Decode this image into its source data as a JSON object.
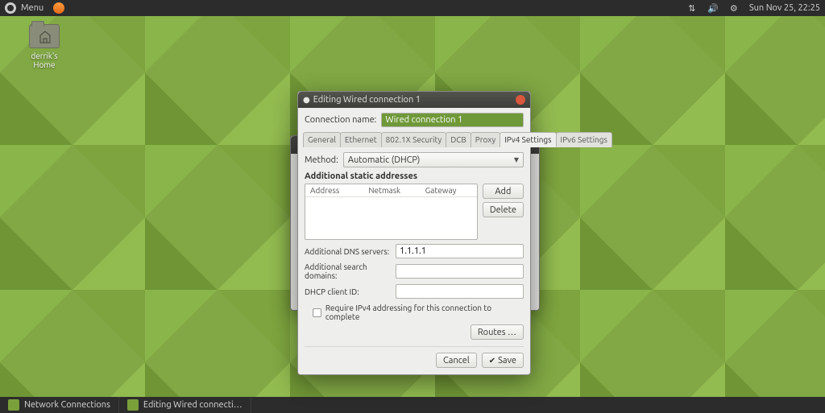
{
  "panel": {
    "menu_label": "Menu",
    "clock": "Sun Nov 25, 22:25"
  },
  "desktop": {
    "home_folder": "derrik's Home"
  },
  "taskbar": {
    "items": [
      "Network Connections",
      "Editing Wired connecti…"
    ]
  },
  "dialog": {
    "title": "Editing Wired connection 1",
    "conn_name_label": "Connection name:",
    "conn_name_value": "Wired connection 1",
    "tabs": [
      "General",
      "Ethernet",
      "802.1X Security",
      "DCB",
      "Proxy",
      "IPv4 Settings",
      "IPv6 Settings"
    ],
    "active_tab": 5,
    "method_label": "Method:",
    "method_value": "Automatic (DHCP)",
    "addresses_title": "Additional static addresses",
    "addr_headers": [
      "Address",
      "Netmask",
      "Gateway"
    ],
    "add_btn": "Add",
    "delete_btn": "Delete",
    "dns_label": "Additional DNS servers:",
    "dns_value": "1.1.1.1",
    "search_label": "Additional search domains:",
    "search_value": "",
    "dhcp_label": "DHCP client ID:",
    "dhcp_value": "",
    "require_label": "Require IPv4 addressing for this connection to complete",
    "routes_btn": "Routes …",
    "cancel_btn": "Cancel",
    "save_btn": "Save"
  }
}
